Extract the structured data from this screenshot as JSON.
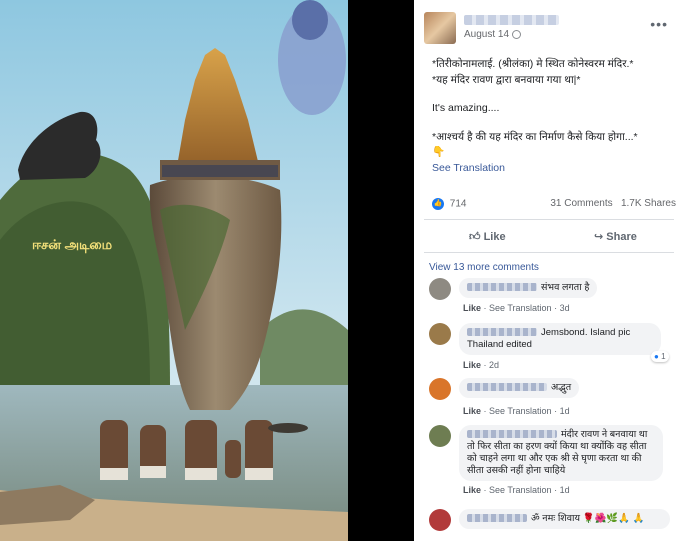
{
  "post": {
    "date": "August 14",
    "more_icon": "•••",
    "lines": [
      "*तिरीकोनामलाई. (श्रीलंका) मे स्थित कोनेस्वरम मंदिर.*",
      "*यह मंदिर रावण द्वारा बनवाया गया था|*",
      "It's amazing....",
      "*आश्चर्य है की यह मंदिर का निर्माण कैसे किया होगा...*",
      "👇"
    ],
    "see_translation": "See Translation",
    "likes_count": "714",
    "comments_count": "31 Comments",
    "shares_count": "1.7K Shares",
    "like_label": "Like",
    "share_label": "Share"
  },
  "image": {
    "watermark": "ஈசன் அடிமை"
  },
  "comments": {
    "view_more": "View 13 more comments",
    "items": [
      {
        "text": "संभव लगता है",
        "actions": [
          "Like",
          "See Translation",
          "3d"
        ],
        "avatar_color": "#8e8a82"
      },
      {
        "text": "Jemsbond. Island pic Thailand edited",
        "actions": [
          "Like",
          "2d"
        ],
        "reaction_count": "1",
        "avatar_color": "#9a7a4a"
      },
      {
        "text": "अद्भुत",
        "actions": [
          "Like",
          "See Translation",
          "1d"
        ],
        "avatar_color": "#d9752a"
      },
      {
        "text": "मंदीर रावण ने बनवाया था तो फिर सीता का हरण क्यों किया था क्योंकि वह सीता को चाहने लगा था और एक श्री से घृणा करता था की सीता उसकी नहीं होना चाहिये",
        "actions": [
          "Like",
          "See Translation",
          "1d"
        ],
        "avatar_color": "#6e7d52"
      },
      {
        "text": "ॐ नमः शिवाय 🌹🌺🌿🙏 🙏",
        "actions": [],
        "avatar_color": "#b23a3a"
      }
    ]
  },
  "colors": {
    "link": "#385898",
    "accent": "#1877f2",
    "muted": "#65676b"
  },
  "icons": {
    "like": "thumbs-up-icon",
    "share": "share-arrow-icon",
    "privacy": "globe-icon"
  }
}
